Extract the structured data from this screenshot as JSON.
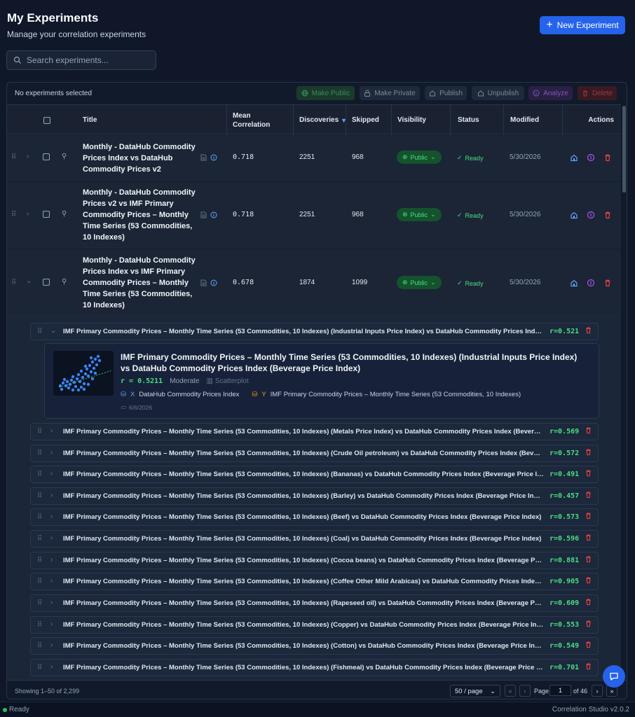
{
  "header": {
    "title": "My Experiments",
    "subtitle": "Manage your correlation experiments",
    "new_button": "New Experiment"
  },
  "search": {
    "placeholder": "Search experiments..."
  },
  "toolbar": {
    "selection": "No experiments selected",
    "make_public": "Make Public",
    "make_private": "Make Private",
    "publish": "Publish",
    "unpublish": "Unpublish",
    "analyze": "Analyze",
    "delete": "Delete"
  },
  "table": {
    "columns": {
      "title": "Title",
      "mean_corr": "Mean Correlation",
      "discoveries": "Discoveries",
      "sort_indicator": "▼",
      "skipped": "Skipped",
      "visibility": "Visibility",
      "status": "Status",
      "modified": "Modified",
      "actions": "Actions"
    },
    "rows": [
      {
        "title": "Monthly - DataHub Commodity Prices Index vs DataHub Commodity Prices v2",
        "mean": "0.718",
        "discoveries": "2251",
        "skipped": "968",
        "visibility": "Public",
        "status": "Ready",
        "modified": "5/30/2026",
        "expanded": false
      },
      {
        "title": "Monthly - DataHub Commodity Prices v2 vs IMF Primary Commodity Prices – Monthly Time Series (53 Commodities, 10 Indexes)",
        "mean": "0.718",
        "discoveries": "2251",
        "skipped": "968",
        "visibility": "Public",
        "status": "Ready",
        "modified": "5/30/2026",
        "expanded": false
      },
      {
        "title": "Monthly - DataHub Commodity Prices Index vs IMF Primary Commodity Prices – Monthly Time Series (53 Commodities, 10 Indexes)",
        "mean": "0.678",
        "discoveries": "1874",
        "skipped": "1099",
        "visibility": "Public",
        "status": "Ready",
        "modified": "5/30/2026",
        "expanded": true
      }
    ]
  },
  "discoveries": [
    {
      "text": "IMF Primary Commodity Prices – Monthly Time Series (53 Commodities, 10 Indexes) (Industrial Inputs Price Index) vs DataHub Commodity Prices Index (Beverage Price Index)",
      "r": "r=0.521",
      "expanded": true
    },
    {
      "text": "IMF Primary Commodity Prices – Monthly Time Series (53 Commodities, 10 Indexes) (Metals Price Index) vs DataHub Commodity Prices Index (Beverage Price Index)",
      "r": "r=0.569"
    },
    {
      "text": "IMF Primary Commodity Prices – Monthly Time Series (53 Commodities, 10 Indexes) (Crude Oil petroleum) vs DataHub Commodity Prices Index (Beverage Price Index)",
      "r": "r=0.572"
    },
    {
      "text": "IMF Primary Commodity Prices – Monthly Time Series (53 Commodities, 10 Indexes) (Bananas) vs DataHub Commodity Prices Index (Beverage Price Index)",
      "r": "r=0.491"
    },
    {
      "text": "IMF Primary Commodity Prices – Monthly Time Series (53 Commodities, 10 Indexes) (Barley) vs DataHub Commodity Prices Index (Beverage Price Index)",
      "r": "r=0.457"
    },
    {
      "text": "IMF Primary Commodity Prices – Monthly Time Series (53 Commodities, 10 Indexes) (Beef) vs DataHub Commodity Prices Index (Beverage Price Index)",
      "r": "r=0.573"
    },
    {
      "text": "IMF Primary Commodity Prices – Monthly Time Series (53 Commodities, 10 Indexes) (Coal) vs DataHub Commodity Prices Index (Beverage Price Index)",
      "r": "r=0.596"
    },
    {
      "text": "IMF Primary Commodity Prices – Monthly Time Series (53 Commodities, 10 Indexes) (Cocoa beans) vs DataHub Commodity Prices Index (Beverage Price Index)",
      "r": "r=0.881"
    },
    {
      "text": "IMF Primary Commodity Prices – Monthly Time Series (53 Commodities, 10 Indexes) (Coffee Other Mild Arabicas) vs DataHub Commodity Prices Index (Beverage Price Index)",
      "r": "r=0.905"
    },
    {
      "text": "IMF Primary Commodity Prices – Monthly Time Series (53 Commodities, 10 Indexes) (Rapeseed oil) vs DataHub Commodity Prices Index (Beverage Price Index)",
      "r": "r=0.609"
    },
    {
      "text": "IMF Primary Commodity Prices – Monthly Time Series (53 Commodities, 10 Indexes) (Copper) vs DataHub Commodity Prices Index (Beverage Price Index)",
      "r": "r=0.553"
    },
    {
      "text": "IMF Primary Commodity Prices – Monthly Time Series (53 Commodities, 10 Indexes) (Cotton) vs DataHub Commodity Prices Index (Beverage Price Index)",
      "r": "r=0.549"
    },
    {
      "text": "IMF Primary Commodity Prices – Monthly Time Series (53 Commodities, 10 Indexes) (Fishmeal) vs DataHub Commodity Prices Index (Beverage Price Index)",
      "r": "r=0.701"
    }
  ],
  "detail": {
    "title": "IMF Primary Commodity Prices – Monthly Time Series (53 Commodities, 10 Indexes) (Industrial Inputs Price Index) vs DataHub Commodity Prices Index (Beverage Price Index)",
    "r_value": "r = 0.5211",
    "strength": "Moderate",
    "chart_type": "Scatterplot",
    "x_axis_letter": "X",
    "x_var": "DataHub Commodity Prices Index",
    "y_axis_letter": "Y",
    "y_var": "IMF Primary Commodity Prices – Monthly Time Series (53 Commodities, 10 Indexes)",
    "date": "6/6/2026"
  },
  "pagination": {
    "showing": "Showing 1–50 of 2,299",
    "per_page": "50 / page",
    "page_label": "Page",
    "current_page": "1",
    "of_total": "of 46"
  },
  "statusbar": {
    "status": "Ready",
    "version": "Correlation Studio v2.0.2"
  },
  "colors": {
    "accent": "#2563eb",
    "positive": "#4ade80",
    "danger": "#ef4444",
    "purple": "#a855f7",
    "background": "#0f1729"
  }
}
